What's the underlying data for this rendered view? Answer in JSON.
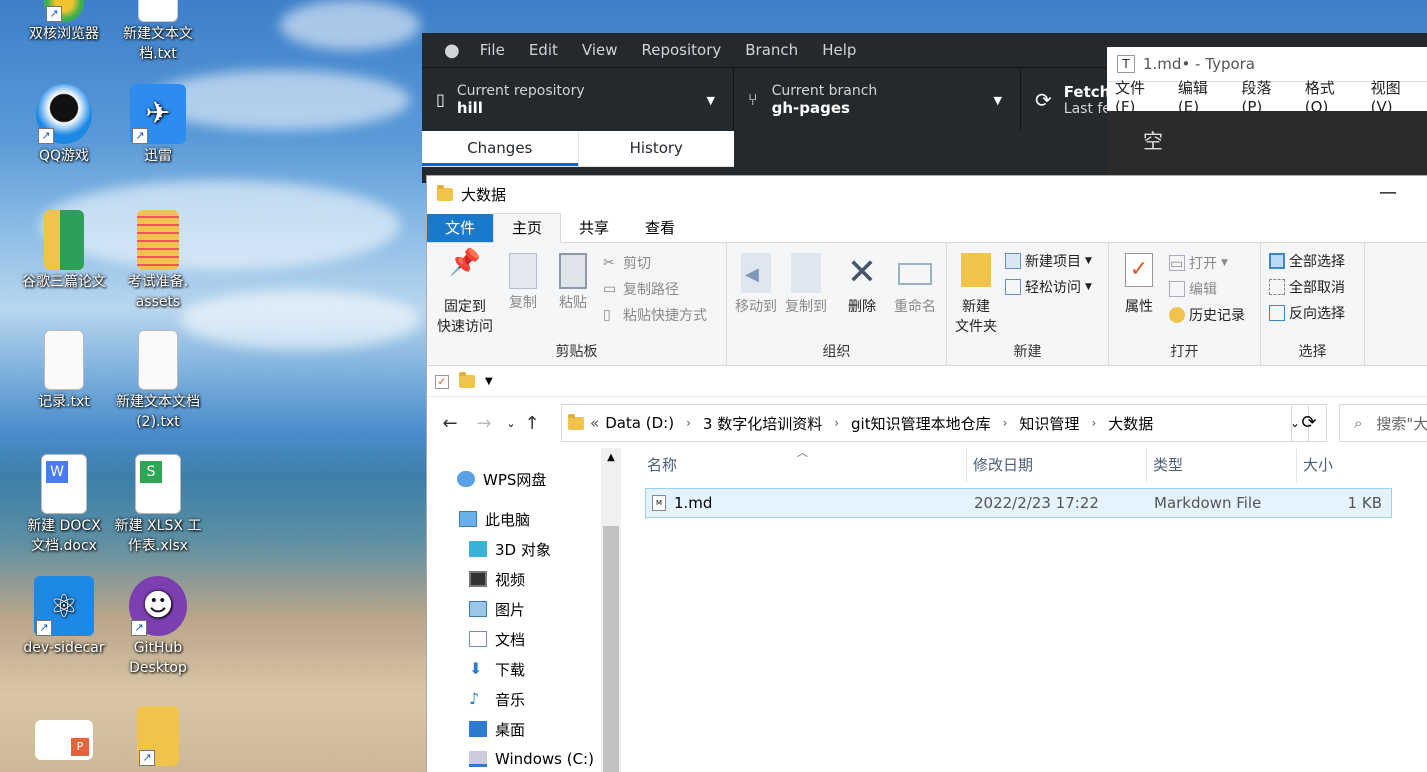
{
  "desktop": {
    "icons": [
      {
        "label": "双核浏览器"
      },
      {
        "label": "新建文本文\n档.txt"
      },
      {
        "label": "QQ游戏"
      },
      {
        "label": "迅雷"
      },
      {
        "label": "谷歌三篇论文"
      },
      {
        "label": "考试准备.\nassets"
      },
      {
        "label": "记录.txt"
      },
      {
        "label": "新建文本文档\n(2).txt"
      },
      {
        "label": "新建 DOCX\n文档.docx"
      },
      {
        "label": "新建 XLSX 工\n作表.xlsx"
      },
      {
        "label": "dev-sidecar"
      },
      {
        "label": "GitHub\nDesktop"
      }
    ]
  },
  "github": {
    "menu": [
      "File",
      "Edit",
      "View",
      "Repository",
      "Branch",
      "Help"
    ],
    "repo_label": "Current repository",
    "repo_value": "hill",
    "branch_label": "Current branch",
    "branch_value": "gh-pages",
    "fetch_label": "Fetch",
    "fetch_sub": "Last fe",
    "tab_changes": "Changes",
    "tab_history": "History"
  },
  "typora": {
    "title": "1.md• - Typora",
    "menu": [
      "文件(F)",
      "编辑(E)",
      "段落(P)",
      "格式(O)",
      "视图(V)"
    ],
    "body_text": "空"
  },
  "explorer": {
    "title": "大数据",
    "minimize": "—",
    "tabs": {
      "file": "文件",
      "home": "主页",
      "share": "共享",
      "view": "查看"
    },
    "clipboard": {
      "pin": "固定到\n快速访问",
      "copy": "复制",
      "paste": "粘贴",
      "cut": "剪切",
      "copy_path": "复制路径",
      "paste_shortcut": "粘贴快捷方式",
      "group": "剪贴板"
    },
    "organize": {
      "move_to": "移动到",
      "copy_to": "复制到",
      "delete": "删除",
      "rename": "重命名",
      "group": "组织"
    },
    "new": {
      "new_folder": "新建\n文件夹",
      "new_item": "新建项目",
      "easy_access": "轻松访问",
      "group": "新建"
    },
    "open": {
      "properties": "属性",
      "open": "打开",
      "edit": "编辑",
      "history": "历史记录",
      "group": "打开"
    },
    "select": {
      "select_all": "全部选择",
      "select_none": "全部取消",
      "invert": "反向选择",
      "group": "选择"
    },
    "breadcrumb": [
      "Data (D:)",
      "3 数字化培训资料",
      "git知识管理本地仓库",
      "知识管理",
      "大数据"
    ],
    "breadcrumb_prefix": "«",
    "search_placeholder": "搜索\"大",
    "nav_items": [
      "WPS网盘",
      "此电脑",
      "3D 对象",
      "视频",
      "图片",
      "文档",
      "下载",
      "音乐",
      "桌面",
      "Windows (C:)"
    ],
    "columns": [
      "名称",
      "修改日期",
      "类型",
      "大小"
    ],
    "files": [
      {
        "name": "1.md",
        "date": "2022/2/23 17:22",
        "type": "Markdown File",
        "size": "1 KB"
      }
    ]
  },
  "colors": {
    "accent": "#1979ca",
    "gh_dark": "#24292e",
    "gh_blue": "#0366d6",
    "folder": "#f0c44c",
    "select": "#e5f3ff"
  }
}
